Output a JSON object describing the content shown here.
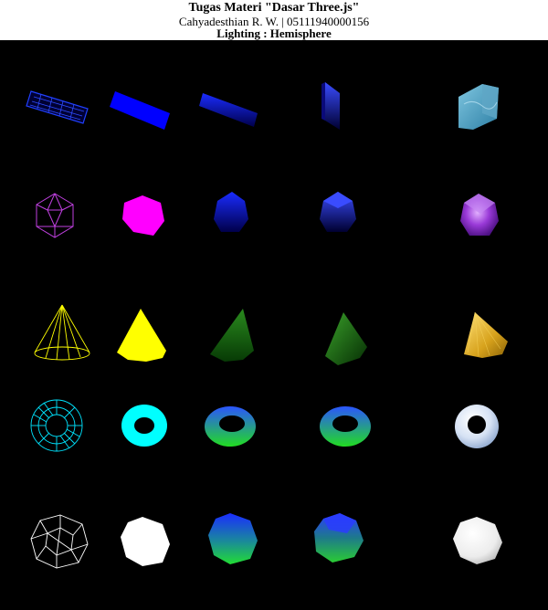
{
  "header": {
    "title": "Tugas Materi \"Dasar Three.js\"",
    "subtitle": "Cahyadesthian R. W. | 05111940000156",
    "lighting_label": "Lighting : Hemisphere"
  },
  "scene": {
    "background": "#000000",
    "rows": [
      {
        "shape": "box",
        "color": "#0000ff",
        "columns": [
          "wireframe",
          "basic",
          "lambert",
          "phong",
          "textured"
        ]
      },
      {
        "shape": "icosahedron",
        "color": "#ff00ff",
        "columns": [
          "wireframe",
          "basic",
          "lambert",
          "phong",
          "textured"
        ]
      },
      {
        "shape": "cone",
        "color": "#ffff00",
        "columns": [
          "wireframe",
          "basic",
          "lambert",
          "phong",
          "textured"
        ]
      },
      {
        "shape": "torus",
        "color": "#00ffff",
        "columns": [
          "wireframe",
          "basic",
          "lambert",
          "phong",
          "textured"
        ]
      },
      {
        "shape": "dodecahedron",
        "color": "#ffffff",
        "columns": [
          "wireframe",
          "basic",
          "lambert",
          "phong",
          "textured"
        ]
      }
    ]
  }
}
